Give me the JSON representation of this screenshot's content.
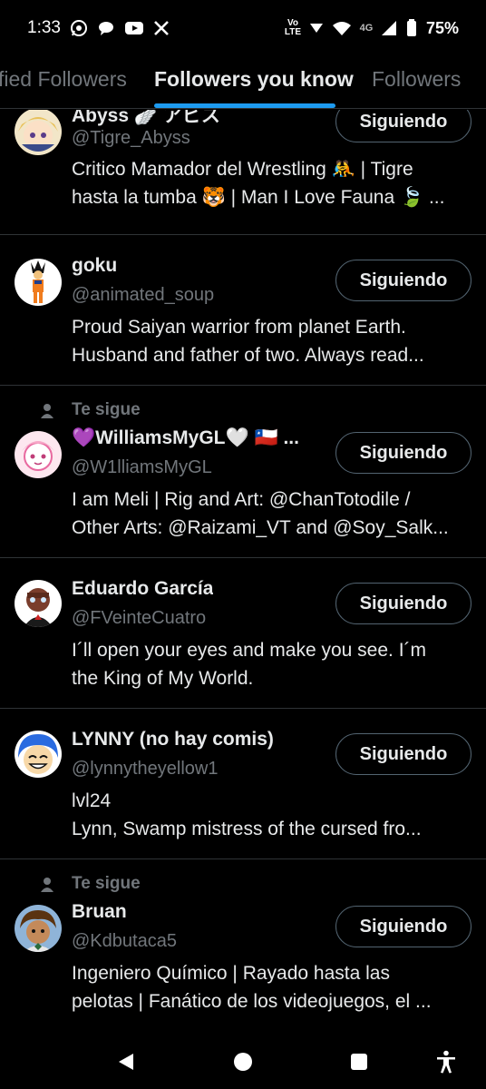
{
  "status_bar": {
    "time": "1:33",
    "battery": "75%",
    "network": "4G",
    "volte": "Vo LTE"
  },
  "tabs": [
    {
      "label": "fied Followers",
      "active": false
    },
    {
      "label": "Followers you know",
      "active": true
    },
    {
      "label": "Followers",
      "active": false
    }
  ],
  "colors": {
    "background": "#000000",
    "accent": "#1d9bf0",
    "secondary_text": "#71767b",
    "divider": "#2f3336"
  },
  "follow_button_label": "Siguiendo",
  "follows_you_label": "Te sigue",
  "users": [
    {
      "name": "Abyss 🪽 アビス",
      "handle": "@Tigre_Abyss",
      "bio_lines": [
        "Critico Mamador del Wrestling 🤼 | Tigre",
        "hasta la tumba 🐯 | Man I Love Fauna 🍃 ..."
      ],
      "follows_you": false
    },
    {
      "name": "goku",
      "handle": "@animated_soup",
      "bio_lines": [
        "Proud Saiyan warrior from planet Earth.",
        "Husband and father of two. Always read..."
      ],
      "follows_you": false
    },
    {
      "name": "💜WilliamsMyGL🤍 🇨🇱 ...",
      "handle": "@W1lliamsMyGL",
      "bio_lines": [
        "I am Meli | Rig and Art: @ChanTotodile /",
        "Other Arts: @Raizami_VT and @Soy_Salk..."
      ],
      "follows_you": true
    },
    {
      "name": "Eduardo García",
      "handle": "@FVeinteCuatro",
      "bio_lines": [
        "I´ll open your eyes and make you see. I´m",
        "the King of My World."
      ],
      "follows_you": false
    },
    {
      "name": "LYNNY (no hay comis)",
      "handle": "@lynnytheyellow1",
      "bio_lines": [
        "lvl24",
        "Lynn, Swamp mistress of the cursed fro..."
      ],
      "follows_you": false
    },
    {
      "name": "Bruan",
      "handle": "@Kdbutaca5",
      "bio_lines": [
        "Ingeniero Químico | Rayado hasta las",
        "pelotas | Fanático de los videojuegos, el ..."
      ],
      "follows_you": true
    }
  ]
}
